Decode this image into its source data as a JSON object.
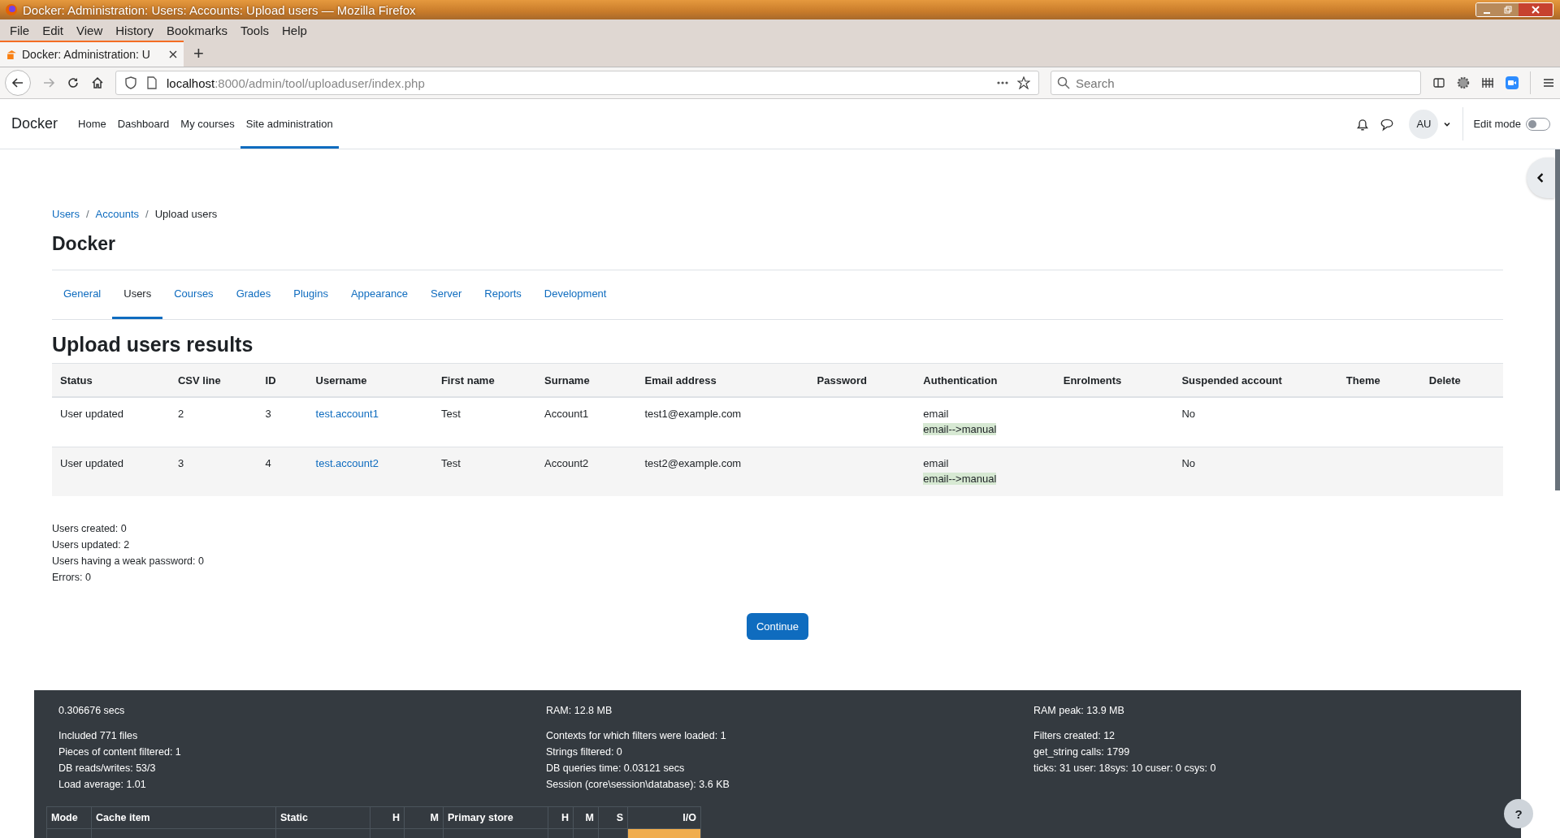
{
  "window": {
    "title": "Docker: Administration: Users: Accounts: Upload users — Mozilla Firefox"
  },
  "menu_bar": [
    "File",
    "Edit",
    "View",
    "History",
    "Bookmarks",
    "Tools",
    "Help"
  ],
  "browser_tabs": [
    {
      "title": "Docker: Administration: U",
      "selected": true
    }
  ],
  "new_tab": "+",
  "address_bar": {
    "host": "localhost",
    "path": ":8000/admin/tool/uploaduser/index.php"
  },
  "search": {
    "placeholder": "Search"
  },
  "site": {
    "brand": "Docker",
    "nav": [
      {
        "label": "Home",
        "selected": false
      },
      {
        "label": "Dashboard",
        "selected": false
      },
      {
        "label": "My courses",
        "selected": false
      },
      {
        "label": "Site administration",
        "selected": true
      }
    ],
    "avatar": "AU",
    "edit_mode": {
      "label": "Edit mode",
      "on": false
    }
  },
  "breadcrumb_separator": "/",
  "breadcrumb": [
    {
      "label": "Users",
      "link": true
    },
    {
      "label": "Accounts",
      "link": true
    },
    {
      "label": "Upload users",
      "link": false
    }
  ],
  "page_title": "Docker",
  "admin_tabs": [
    {
      "label": "General",
      "selected": false
    },
    {
      "label": "Users",
      "selected": true
    },
    {
      "label": "Courses",
      "selected": false
    },
    {
      "label": "Grades",
      "selected": false
    },
    {
      "label": "Plugins",
      "selected": false
    },
    {
      "label": "Appearance",
      "selected": false
    },
    {
      "label": "Server",
      "selected": false
    },
    {
      "label": "Reports",
      "selected": false
    },
    {
      "label": "Development",
      "selected": false
    }
  ],
  "section_title": "Upload users results",
  "table": {
    "columns": [
      "Status",
      "CSV line",
      "ID",
      "Username",
      "First name",
      "Surname",
      "Email address",
      "Password",
      "Authentication",
      "Enrolments",
      "Suspended account",
      "Theme",
      "Delete"
    ],
    "rows": [
      {
        "status": "User updated",
        "csv_line": "2",
        "id": "3",
        "username": "test.account1",
        "first_name": "Test",
        "surname": "Account1",
        "email": "test1@example.com",
        "auth": "email",
        "auth_change": "email-->manual",
        "suspended": "No"
      },
      {
        "status": "User updated",
        "csv_line": "3",
        "id": "4",
        "username": "test.account2",
        "first_name": "Test",
        "surname": "Account2",
        "email": "test2@example.com",
        "auth": "email",
        "auth_change": "email-->manual",
        "suspended": "No"
      }
    ]
  },
  "summary": [
    "Users created: 0",
    "Users updated: 2",
    "Users having a weak password: 0",
    "Errors: 0"
  ],
  "continue_button": "Continue",
  "footer": {
    "columns": [
      {
        "head": "0.306676 secs",
        "lines": [
          "Included 771 files",
          "Pieces of content filtered: 1",
          "DB reads/writes: 53/3",
          "Load average: 1.01"
        ]
      },
      {
        "head": "RAM: 12.8 MB",
        "lines": [
          "Contexts for which filters were loaded: 1",
          "Strings filtered: 0",
          "DB queries time: 0.03121 secs",
          "Session (core\\session\\database): 3.6 KB"
        ]
      },
      {
        "head": "RAM peak: 13.9 MB",
        "lines": [
          "Filters created: 12",
          "get_string calls: 1799",
          "ticks: 31 user: 18sys: 10 cuser: 0 csys: 0"
        ]
      }
    ],
    "cache_table": {
      "columns": [
        "Mode",
        "Cache item",
        "Static",
        "H",
        "M",
        "Primary store",
        "H",
        "M",
        "S",
        "I/O"
      ]
    }
  },
  "help_button": "?"
}
